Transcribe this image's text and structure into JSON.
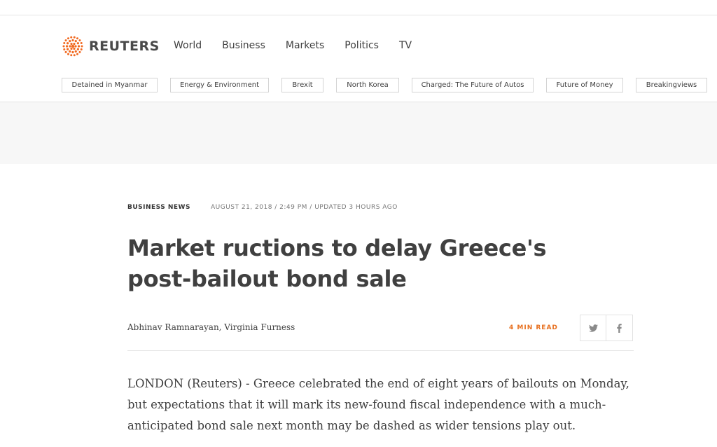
{
  "brand": {
    "name": "REUTERS",
    "logo_color": "#f26a21"
  },
  "nav": [
    "World",
    "Business",
    "Markets",
    "Politics",
    "TV"
  ],
  "trending": [
    "Detained in Myanmar",
    "Energy & Environment",
    "Brexit",
    "North Korea",
    "Charged: The Future of Autos",
    "Future of Money",
    "Breakingviews"
  ],
  "article": {
    "channel": "BUSINESS NEWS",
    "dateline": "AUGUST 21, 2018 / 2:49 PM / UPDATED 3 HOURS AGO",
    "title": "Market ructions to delay Greece's post-bailout bond sale",
    "byline": "Abhinav Ramnarayan, Virginia Furness",
    "read_time": "4 MIN READ",
    "share_icons": [
      "twitter-icon",
      "facebook-icon"
    ],
    "body": "LONDON (Reuters) - Greece celebrated the end of eight years of bailouts on Monday, but expectations that it will mark its new-found fiscal independence with a much-anticipated bond sale next month may be dashed as wider tensions play out."
  },
  "colors": {
    "accent": "#e76f1e",
    "text": "#404040",
    "ad_band": "#f7f7f7"
  }
}
